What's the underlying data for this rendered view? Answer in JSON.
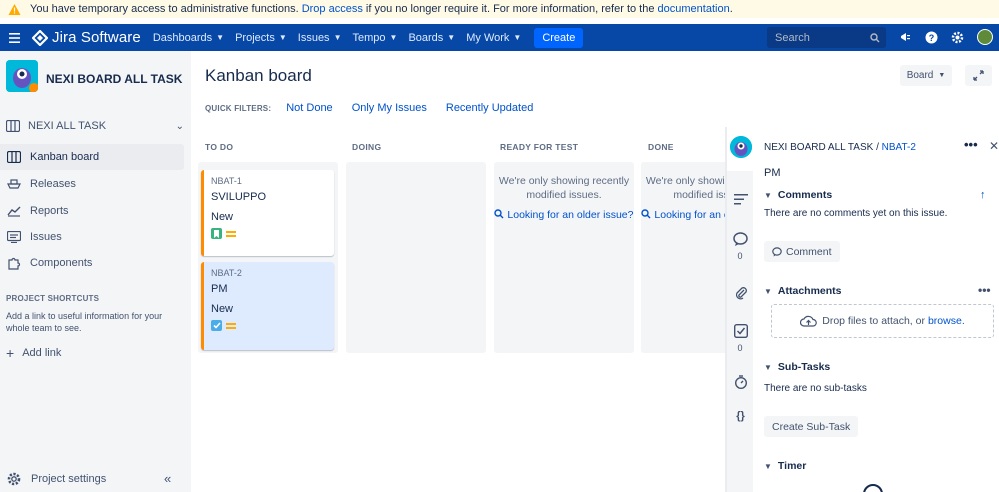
{
  "banner": {
    "text_before": "You have temporary access to administrative functions.",
    "link1": "Drop access",
    "text_middle": "if you no longer require it. For more information, refer to the",
    "link2": "documentation",
    "text_after": "."
  },
  "topnav": {
    "product": "Jira Software",
    "menu": [
      "Dashboards",
      "Projects",
      "Issues",
      "Tempo",
      "Boards",
      "My Work"
    ],
    "create_label": "Create",
    "search_placeholder": "Search"
  },
  "sidebar": {
    "project_name": "NEXI BOARD ALL TASK",
    "board_selector": "NEXI ALL TASK",
    "items": [
      {
        "label": "Kanban board",
        "icon": "board-icon",
        "active": true
      },
      {
        "label": "Releases",
        "icon": "ship-icon",
        "active": false
      },
      {
        "label": "Reports",
        "icon": "chart-icon",
        "active": false
      },
      {
        "label": "Issues",
        "icon": "issues-icon",
        "active": false
      },
      {
        "label": "Components",
        "icon": "puzzle-icon",
        "active": false
      }
    ],
    "shortcuts_title": "PROJECT SHORTCUTS",
    "shortcuts_desc": "Add a link to useful information for your whole team to see.",
    "add_link": "Add link",
    "project_settings": "Project settings"
  },
  "main": {
    "title": "Kanban board",
    "board_button": "Board",
    "quick_filters_label": "QUICK FILTERS:",
    "quick_filters": [
      "Not Done",
      "Only My Issues",
      "Recently Updated"
    ],
    "columns": [
      {
        "name": "TO DO"
      },
      {
        "name": "DOING"
      },
      {
        "name": "READY FOR TEST",
        "empty_msg": "We're only showing recently modified issues.",
        "empty_link": "Looking for an older issue?"
      },
      {
        "name": "DONE",
        "empty_msg": "We're only showing recently modified issues.",
        "empty_link": "Looking for an older issue?"
      }
    ],
    "cards": [
      {
        "key": "NBAT-1",
        "summary": "SVILUPPO",
        "status": "New",
        "type": "story"
      },
      {
        "key": "NBAT-2",
        "summary": "PM",
        "status": "New",
        "type": "task"
      }
    ]
  },
  "detail": {
    "project": "NEXI BOARD ALL TASK",
    "separator": "/",
    "issue_key": "NBAT-2",
    "summary": "PM",
    "comments_title": "Comments",
    "comments_empty": "There are no comments yet on this issue.",
    "comment_button": "Comment",
    "attachments_title": "Attachments",
    "drop_text": "Drop files to attach, or",
    "browse": "browse.",
    "subtasks_title": "Sub-Tasks",
    "subtasks_empty": "There are no sub-tasks",
    "create_subtask": "Create Sub-Task",
    "timer_title": "Timer",
    "comments_count": "0",
    "checklist_count": "0"
  },
  "colors": {
    "nav": "#0747a6",
    "create": "#0065ff",
    "link": "#0052cc",
    "card_border": "#ff8b00",
    "selected_card": "#deebff"
  }
}
